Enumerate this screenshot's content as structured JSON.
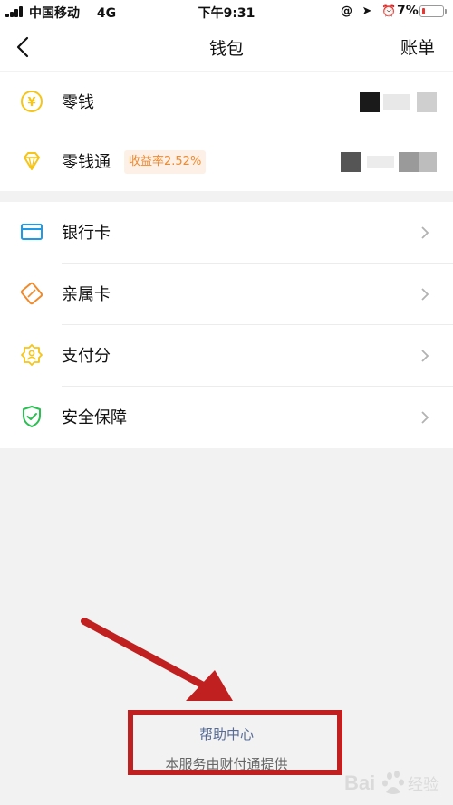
{
  "status_bar": {
    "carrier": "中国移动",
    "network": "4G",
    "time": "下午9:31",
    "battery_percent": "7%",
    "battery_level": 0.07
  },
  "nav": {
    "title": "钱包",
    "right_action": "账单"
  },
  "balance_section": [
    {
      "label": "零钱",
      "icon": "yuan-coin-icon"
    },
    {
      "label": "零钱通",
      "icon": "diamond-icon",
      "badge": "收益率2.52%"
    }
  ],
  "menu_section": [
    {
      "label": "银行卡",
      "icon": "bank-card-icon"
    },
    {
      "label": "亲属卡",
      "icon": "family-card-icon"
    },
    {
      "label": "支付分",
      "icon": "pay-score-icon"
    },
    {
      "label": "安全保障",
      "icon": "security-shield-icon"
    }
  ],
  "footer": {
    "help_link": "帮助中心",
    "provider_note": "本服务由财付通提供"
  },
  "colors": {
    "accent_yellow": "#f5c518",
    "card_blue": "#1e9be8",
    "family_orange": "#f08a2a",
    "shield_green": "#2bbf52",
    "link_blue": "#576b95",
    "badge_orange": "#ee8a30",
    "annotation_red": "#c0201f"
  }
}
